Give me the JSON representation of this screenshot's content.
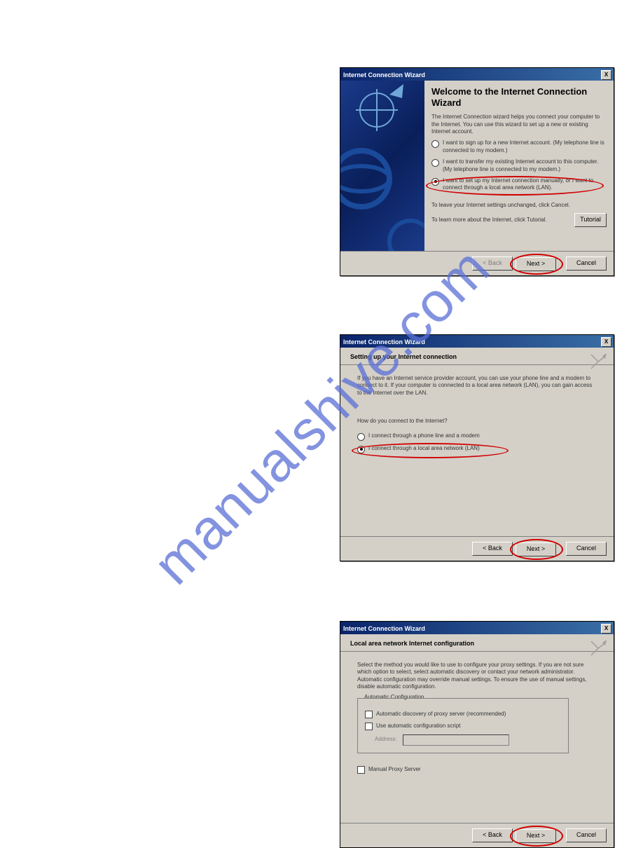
{
  "watermark": "manualshive.com",
  "dialog1": {
    "title": "Internet Connection Wizard",
    "heading": "Welcome to the Internet Connection Wizard",
    "intro": "The Internet Connection wizard helps you connect your computer to the Internet. You can use this wizard to set up a new or existing Internet account.",
    "opt1": "I want to sign up for a new Internet account. (My telephone line is connected to my modem.)",
    "opt2": "I want to transfer my existing Internet account to this computer. (My telephone line is connected to my modem.)",
    "opt3": "I want to set up my Internet connection manually, or I want to connect through a local area network (LAN).",
    "leave": "To leave your Internet settings unchanged, click Cancel.",
    "learn": "To learn more about the Internet, click Tutorial.",
    "tutorial_btn": "Tutorial",
    "back_btn": "< Back",
    "next_btn": "Next >",
    "cancel_btn": "Cancel"
  },
  "dialog2": {
    "title": "Internet Connection Wizard",
    "heading": "Setting up your Internet connection",
    "intro": "If you have an Internet service provider account, you can use your phone line and a modem to connect to it. If your computer is connected to a local area network (LAN), you can gain access to the Internet over the LAN.",
    "question": "How do you connect to the Internet?",
    "opt1": "I connect through a phone line and a modem",
    "opt2": "I connect through a local area network (LAN)",
    "back_btn": "< Back",
    "next_btn": "Next >",
    "cancel_btn": "Cancel"
  },
  "dialog3": {
    "title": "Internet Connection Wizard",
    "heading": "Local area network Internet configuration",
    "intro": "Select the method you would like to use to configure your proxy settings. If you are not sure which option to select, select automatic discovery or contact your network administrator. Automatic configuration may override manual settings. To ensure the use of manual settings, disable automatic configuration.",
    "group_legend": "Automatic Configuration",
    "chk1": "Automatic discovery of proxy server (recommended)",
    "chk2": "Use automatic configuration script",
    "addr_label": "Address:",
    "chk3": "Manual Proxy Server",
    "back_btn": "< Back",
    "next_btn": "Next >",
    "cancel_btn": "Cancel"
  }
}
